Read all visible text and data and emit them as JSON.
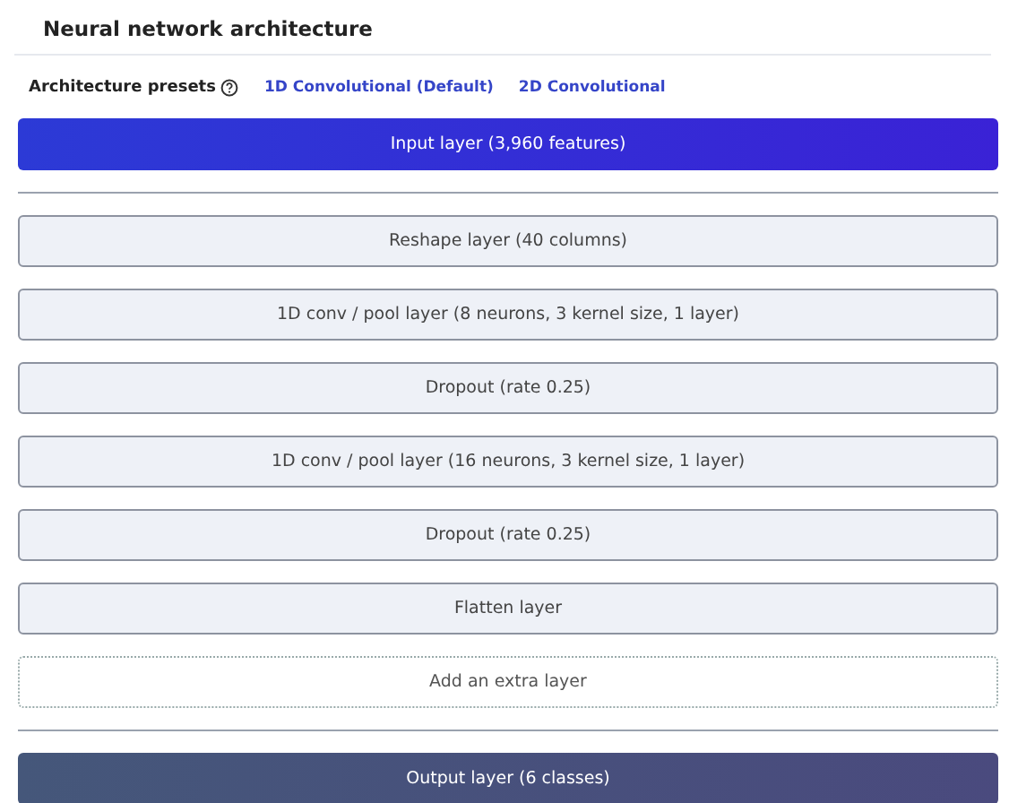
{
  "title": "Neural network architecture",
  "presets": {
    "label": "Architecture presets",
    "options": [
      {
        "label": "1D Convolutional (Default)"
      },
      {
        "label": "2D Convolutional"
      }
    ]
  },
  "layers": [
    {
      "kind": "input",
      "label": "Input layer (3,960 features)"
    },
    {
      "kind": "hidden",
      "label": "Reshape layer (40 columns)"
    },
    {
      "kind": "hidden",
      "label": "1D conv / pool layer (8 neurons, 3 kernel size, 1 layer)"
    },
    {
      "kind": "hidden",
      "label": "Dropout (rate 0.25)"
    },
    {
      "kind": "hidden",
      "label": "1D conv / pool layer (16 neurons, 3 kernel size, 1 layer)"
    },
    {
      "kind": "hidden",
      "label": "Dropout (rate 0.25)"
    },
    {
      "kind": "hidden",
      "label": "Flatten layer"
    },
    {
      "kind": "add",
      "label": "Add an extra layer"
    },
    {
      "kind": "output",
      "label": "Output layer (6 classes)"
    }
  ]
}
